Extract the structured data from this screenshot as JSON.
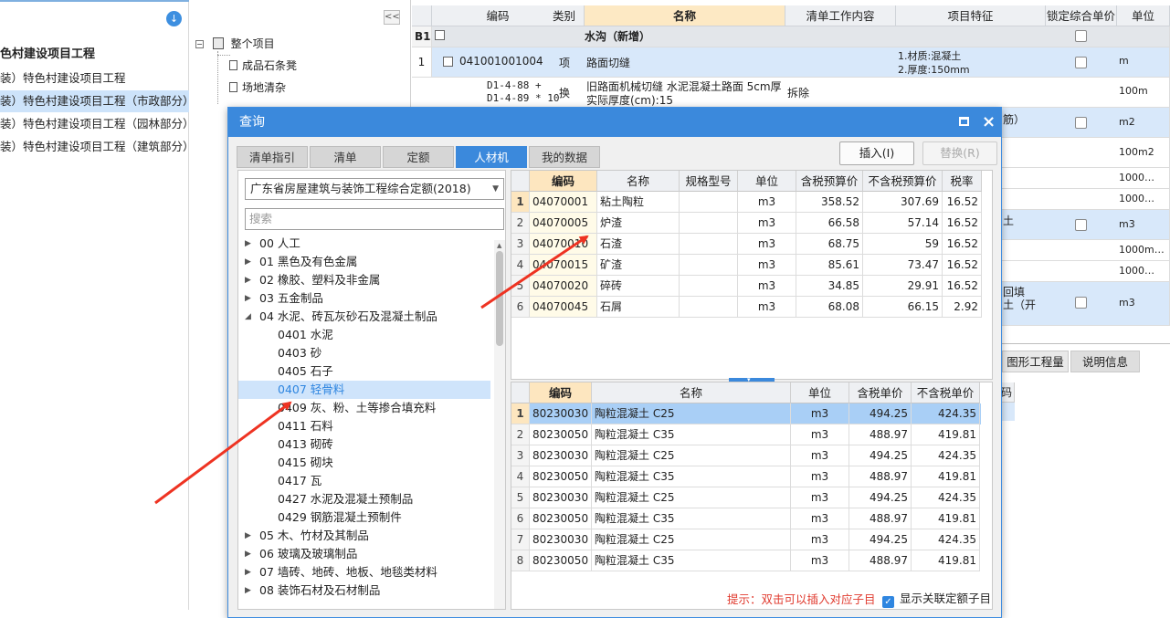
{
  "left_panel": {
    "title": "色村建设项目工程",
    "items": [
      {
        "label": "装）特色村建设项目工程",
        "selected": false
      },
      {
        "label": "装）特色村建设项目工程（市政部分）",
        "selected": true
      },
      {
        "label": "装）特色村建设项目工程（园林部分）",
        "selected": false
      },
      {
        "label": "装）特色村建设项目工程（建筑部分）",
        "selected": false
      }
    ],
    "download_icon": "download-icon"
  },
  "mid_panel": {
    "collapse_label": "<<",
    "root": "整个项目",
    "children": [
      "成品石条凳",
      "场地清杂"
    ]
  },
  "grid": {
    "headers": [
      "编码",
      "类别",
      "名称",
      "清单工作内容",
      "项目特征",
      "锁定综合单价",
      "单位"
    ],
    "row_b1": {
      "num": "B1",
      "name": "水沟（新增）"
    },
    "row_1": {
      "num": "1",
      "code": "041001001004",
      "type": "项",
      "name": "路面切缝",
      "feature1": "1.材质:混凝土",
      "feature2": "2.厚度:150mm",
      "unit": "m"
    },
    "row_sub": {
      "code1": "D1-4-88 +",
      "code2": "D1-4-89 * 10",
      "type": "换",
      "name1": "旧路面机械切缝 水泥混凝土路面 5cm厚",
      "name2": "实际厚度(cm):15",
      "content": "拆除",
      "unit": "100m"
    },
    "side_texts": [
      "筋）",
      "土",
      "回填",
      "土（开"
    ],
    "units": [
      "m2",
      "100m2",
      "1000…",
      "1000…",
      "m3",
      "1000m…",
      "1000…",
      "m3"
    ],
    "bottom_tabs": [
      "图形工程量",
      "说明信息"
    ],
    "bottom_header": "码"
  },
  "dialog": {
    "title": "查询",
    "tabs": [
      "清单指引",
      "清单",
      "定额",
      "人材机",
      "我的数据"
    ],
    "active_tab": "人材机",
    "insert_label": "插入(I)",
    "replace_label": "替换(R)",
    "quota_select": "广东省房屋建筑与装饰工程综合定额(2018)",
    "search_placeholder": "搜索",
    "tree": [
      {
        "label": "00 人工",
        "level": 0,
        "caret": "right"
      },
      {
        "label": "01 黑色及有色金属",
        "level": 0,
        "caret": "right"
      },
      {
        "label": "02 橡胶、塑料及非金属",
        "level": 0,
        "caret": "right"
      },
      {
        "label": "03 五金制品",
        "level": 0,
        "caret": "right"
      },
      {
        "label": "04 水泥、砖瓦灰砂石及混凝土制品",
        "level": 0,
        "caret": "down"
      },
      {
        "label": "0401 水泥",
        "level": 1
      },
      {
        "label": "0403 砂",
        "level": 1
      },
      {
        "label": "0405 石子",
        "level": 1
      },
      {
        "label": "0407 轻骨料",
        "level": 1,
        "selected": true
      },
      {
        "label": "0409 灰、粉、土等掺合填充料",
        "level": 1
      },
      {
        "label": "0411 石料",
        "level": 1
      },
      {
        "label": "0413 砌砖",
        "level": 1
      },
      {
        "label": "0415 砌块",
        "level": 1
      },
      {
        "label": "0417 瓦",
        "level": 1
      },
      {
        "label": "0427 水泥及混凝土预制品",
        "level": 1
      },
      {
        "label": "0429 钢筋混凝土预制件",
        "level": 1
      },
      {
        "label": "05 木、竹材及其制品",
        "level": 0,
        "caret": "right"
      },
      {
        "label": "06 玻璃及玻璃制品",
        "level": 0,
        "caret": "right"
      },
      {
        "label": "07 墙砖、地砖、地板、地毯类材料",
        "level": 0,
        "caret": "right"
      },
      {
        "label": "08 装饰石材及石材制品",
        "level": 0,
        "caret": "right"
      }
    ],
    "material_headers": [
      "编码",
      "名称",
      "规格型号",
      "单位",
      "含税预算价",
      "不含税预算价",
      "税率"
    ],
    "materials": [
      [
        "1",
        "04070001",
        "粘土陶粒",
        "",
        "m3",
        "358.52",
        "307.69",
        "16.52"
      ],
      [
        "2",
        "04070005",
        "炉渣",
        "",
        "m3",
        "66.58",
        "57.14",
        "16.52"
      ],
      [
        "3",
        "04070010",
        "石渣",
        "",
        "m3",
        "68.75",
        "59",
        "16.52"
      ],
      [
        "4",
        "04070015",
        "矿渣",
        "",
        "m3",
        "85.61",
        "73.47",
        "16.52"
      ],
      [
        "5",
        "04070020",
        "碎砖",
        "",
        "m3",
        "34.85",
        "29.91",
        "16.52"
      ],
      [
        "6",
        "04070045",
        "石屑",
        "",
        "m3",
        "68.08",
        "66.15",
        "2.92"
      ]
    ],
    "quota_headers": [
      "编码",
      "名称",
      "单位",
      "含税单价",
      "不含税单价"
    ],
    "quotas": [
      [
        "1",
        "80230030",
        "陶粒混凝土 C25",
        "m3",
        "494.25",
        "424.35"
      ],
      [
        "2",
        "80230050",
        "陶粒混凝土 C35",
        "m3",
        "488.97",
        "419.81"
      ],
      [
        "3",
        "80230030",
        "陶粒混凝土 C25",
        "m3",
        "494.25",
        "424.35"
      ],
      [
        "4",
        "80230050",
        "陶粒混凝土 C35",
        "m3",
        "488.97",
        "419.81"
      ],
      [
        "5",
        "80230030",
        "陶粒混凝土 C25",
        "m3",
        "494.25",
        "424.35"
      ],
      [
        "6",
        "80230050",
        "陶粒混凝土 C35",
        "m3",
        "488.97",
        "419.81"
      ],
      [
        "7",
        "80230030",
        "陶粒混凝土 C25",
        "m3",
        "494.25",
        "424.35"
      ],
      [
        "8",
        "80230050",
        "陶粒混凝土 C35",
        "m3",
        "488.97",
        "419.81"
      ]
    ],
    "hint": "提示：双击可以插入对应子目",
    "show_linked": "显示关联定额子目",
    "colors": {
      "accent": "#3b89dc",
      "header_active": "#fde6bf",
      "hint": "#e03a2e",
      "arrow": "#ee3322"
    }
  }
}
